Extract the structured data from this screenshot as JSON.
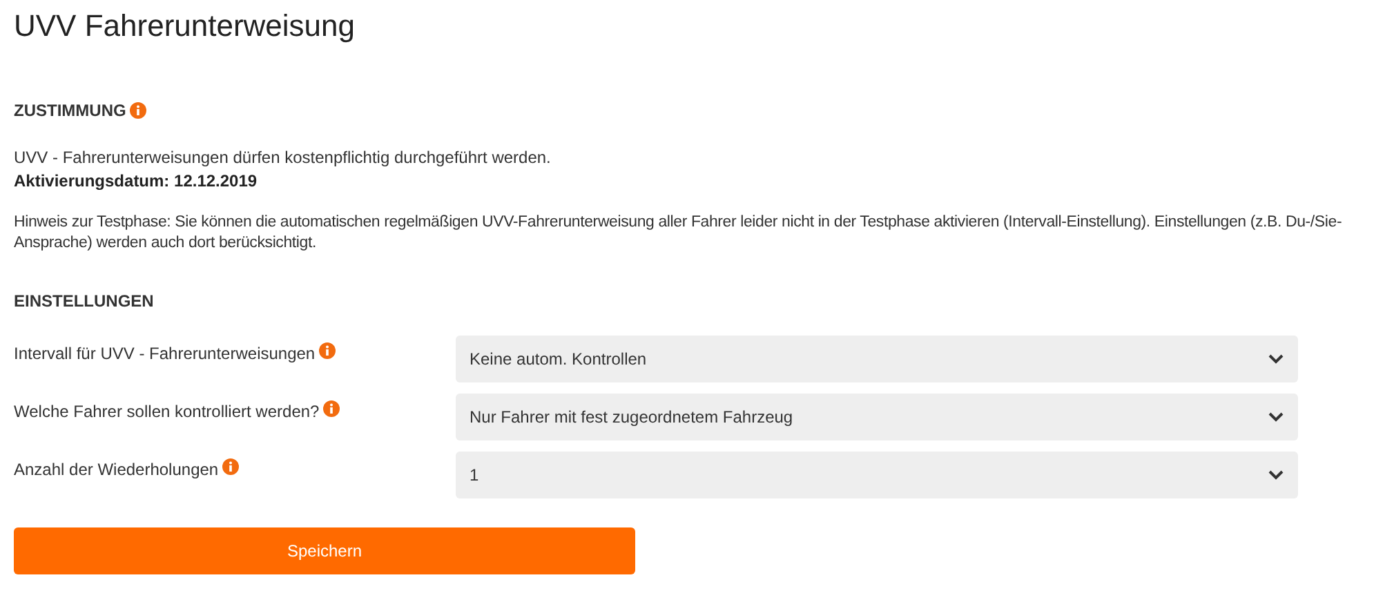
{
  "title": "UVV Fahrerunterweisung",
  "consent": {
    "heading": "ZUSTIMMUNG",
    "text": "UVV - Fahrerunterweisungen dürfen kostenpflichtig durchgeführt werden.",
    "activation": "Aktivierungsdatum: 12.12.2019",
    "note": "Hinweis zur Testphase: Sie können die automatischen regelmäßigen UVV-Fahrerunterweisung aller Fahrer leider nicht in der Testphase aktivieren (Intervall-Einstellung). Einstellungen (z.B. Du-/Sie-Ansprache) werden auch dort berücksichtigt."
  },
  "settings": {
    "heading": "EINSTELLUNGEN",
    "fields": [
      {
        "label": "Intervall für UVV - Fahrerunterweisungen",
        "value": "Keine autom. Kontrollen"
      },
      {
        "label": "Welche Fahrer sollen kontrolliert werden?",
        "value": "Nur Fahrer mit fest zugeordnetem Fahrzeug"
      },
      {
        "label": "Anzahl der Wiederholungen",
        "value": "1"
      }
    ]
  },
  "save_button": "Speichern"
}
